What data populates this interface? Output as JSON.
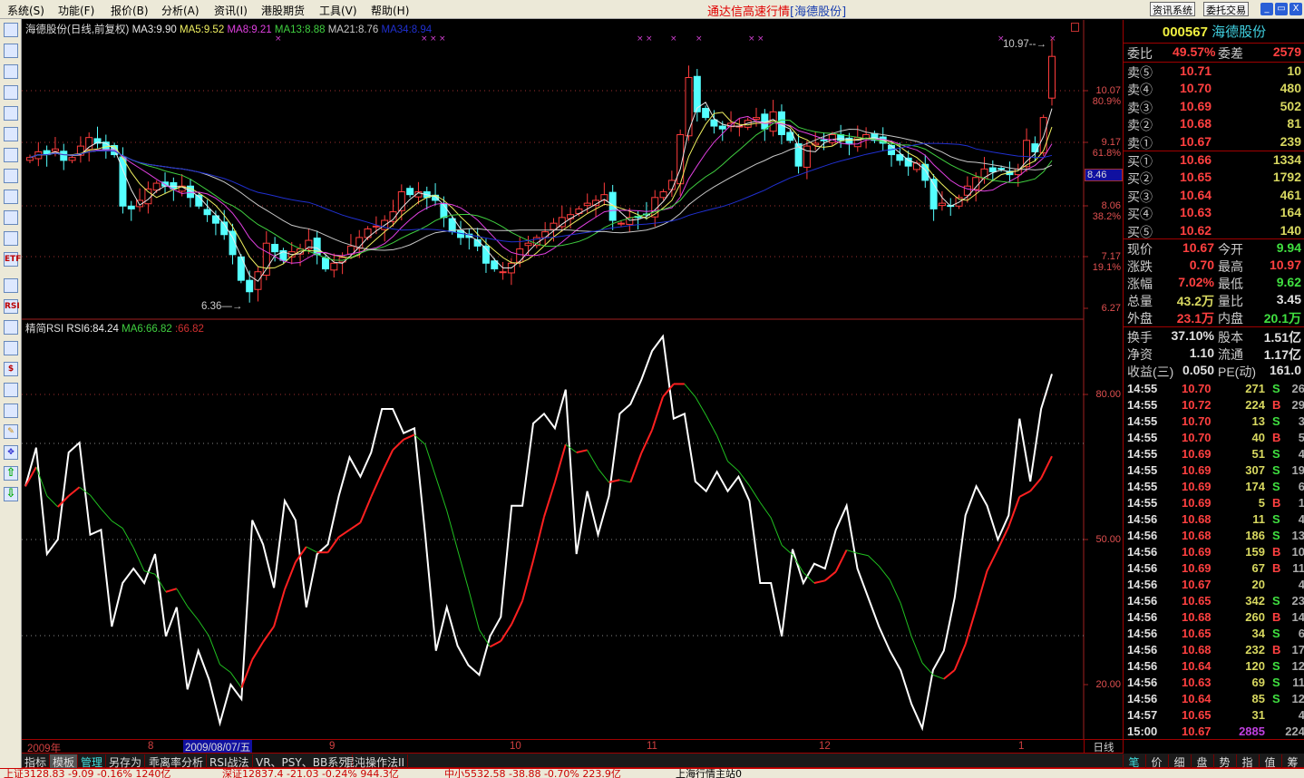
{
  "menu": [
    "系统(S)",
    "功能(F)",
    "报价(B)",
    "分析(A)",
    "资讯(I)",
    "港股期货",
    "工具(V)",
    "帮助(H)"
  ],
  "app_title": "通达信高速行情",
  "app_title_stock": "[海德股份]",
  "top_buttons": {
    "news": "资讯系统",
    "trade": "委托交易"
  },
  "window_buttons": {
    "min": "_",
    "restore": "▭",
    "close": "X"
  },
  "left_toolbar_icons": [
    "quote-icon",
    "grid-icon",
    "line-chart-icon",
    "kline-icon",
    "windows-icon",
    "list-icon",
    "tree-icon",
    "mail-icon",
    "users-icon",
    "formula-icon",
    "search-icon",
    "etf-icon",
    "wave-icon",
    "rsi-icon",
    "refresh-icon",
    "layout-icon",
    "dollar-icon",
    "tools-icon",
    "import-icon",
    "pencil-icon",
    "move-icon",
    "up-arrow-icon",
    "down-arrow-icon"
  ],
  "left_toolbar_text": {
    "etf": "ETF",
    "rsi": "RSI"
  },
  "main_chart": {
    "title": "海德股份(日线,前复权)",
    "ma": [
      {
        "label": "MA3:9.90",
        "color": "#e8e8e8",
        "period": 3
      },
      {
        "label": "MA5:9.52",
        "color": "#f0f060",
        "period": 5
      },
      {
        "label": "MA8:9.21",
        "color": "#e040e0",
        "period": 8
      },
      {
        "label": "MA13:8.88",
        "color": "#40d040",
        "period": 13
      },
      {
        "label": "MA21:8.76",
        "color": "#c8c8c8",
        "period": 21
      },
      {
        "label": "MA34:8.94",
        "color": "#2030d0",
        "period": 34
      }
    ],
    "price_axis": [
      {
        "price": "10.07",
        "pct": "80.9%"
      },
      {
        "price": "9.17",
        "pct": "61.8%"
      },
      {
        "price": "8.06",
        "pct": "38.2%"
      },
      {
        "price": "7.17",
        "pct": "19.1%"
      },
      {
        "price": "6.27",
        "pct": ""
      }
    ],
    "cursor_price": "8.46",
    "high_label": "10.97",
    "low_label": "6.36",
    "last_open": 9.94,
    "high_value": 10.97,
    "low_value": 6.36,
    "low_index": 26,
    "closes": [
      8.9,
      9.0,
      8.95,
      9.05,
      8.85,
      8.9,
      9.1,
      9.25,
      9.15,
      9.05,
      8.95,
      8.05,
      8.0,
      8.15,
      8.35,
      8.45,
      8.4,
      8.35,
      8.4,
      8.2,
      8.05,
      7.9,
      7.75,
      7.55,
      7.2,
      6.75,
      6.55,
      6.9,
      7.4,
      7.25,
      7.1,
      7.25,
      7.3,
      7.45,
      7.2,
      6.95,
      7.05,
      7.15,
      7.35,
      7.5,
      7.65,
      7.7,
      7.8,
      7.95,
      8.3,
      8.25,
      8.3,
      8.2,
      8.15,
      7.85,
      7.6,
      7.5,
      7.5,
      7.35,
      7.05,
      6.95,
      6.9,
      7.05,
      7.3,
      7.4,
      7.5,
      7.6,
      7.75,
      7.85,
      7.9,
      8.0,
      8.1,
      8.15,
      8.25,
      7.8,
      7.75,
      7.85,
      7.85,
      7.9,
      8.2,
      8.3,
      8.5,
      9.3,
      10.3,
      9.7,
      9.6,
      9.45,
      9.4,
      9.5,
      9.45,
      9.55,
      9.6,
      9.4,
      9.7,
      9.3,
      9.2,
      8.75,
      9.1,
      9.15,
      9.2,
      9.3,
      9.2,
      9.15,
      9.25,
      9.3,
      9.2,
      9.15,
      8.95,
      8.85,
      8.75,
      8.8,
      8.5,
      8.0,
      8.1,
      8.05,
      8.2,
      8.4,
      8.55,
      8.7,
      8.65,
      8.7,
      8.6,
      8.7,
      9.2,
      9.0,
      9.6,
      10.67
    ]
  },
  "rsi_chart": {
    "title": "精简RSI",
    "rsi_label": "RSI6:84.24",
    "ma_label": "MA6:66.82",
    "extra_label": ":66.82",
    "axis": [
      "80.00",
      "50.00",
      "20.00"
    ],
    "rsi6": [
      61,
      69,
      47,
      50,
      68,
      70,
      51,
      52,
      32,
      41,
      44,
      41,
      47,
      30,
      36,
      19,
      27,
      21,
      12,
      20,
      17,
      54,
      49,
      40,
      58,
      54,
      36,
      47,
      49,
      59,
      67,
      63,
      68,
      77,
      77,
      72,
      73,
      51,
      27,
      36,
      28,
      24,
      22,
      30,
      34,
      57,
      57,
      74,
      76,
      73,
      81,
      47,
      60,
      51,
      59,
      76,
      78,
      83,
      89,
      92,
      75,
      76,
      62,
      60,
      64,
      60,
      63,
      58,
      41,
      41,
      30,
      48,
      41,
      45,
      44,
      52,
      57,
      44,
      38,
      32,
      27,
      23,
      16,
      11,
      23,
      27,
      38,
      55,
      61,
      57,
      50,
      55,
      75,
      62,
      77,
      84.24
    ]
  },
  "date_axis": {
    "year": "2009年",
    "m8": "8",
    "cursor_date": "2009/08/07/五",
    "m9": "9",
    "m10": "10",
    "m11": "11",
    "m12": "12",
    "m1": "1",
    "period": "日线"
  },
  "bottom_tabs": [
    "指标",
    "模板",
    "管理",
    "另存为",
    "乖离率分析",
    "RSI战法",
    "VR、PSY、BB系列",
    "混沌操作法II"
  ],
  "right_tabs": [
    "笔",
    "价",
    "细",
    "盘",
    "势",
    "指",
    "值",
    "筹"
  ],
  "quote": {
    "code": "000567",
    "name": "海德股份",
    "weibi_label": "委比",
    "weibi": "49.57%",
    "weicha_label": "委差",
    "weicha": "2579",
    "sell": [
      {
        "label": "卖⑤",
        "price": "10.71",
        "vol": "10"
      },
      {
        "label": "卖④",
        "price": "10.70",
        "vol": "480"
      },
      {
        "label": "卖③",
        "price": "10.69",
        "vol": "502"
      },
      {
        "label": "卖②",
        "price": "10.68",
        "vol": "81"
      },
      {
        "label": "卖①",
        "price": "10.67",
        "vol": "239"
      }
    ],
    "buy": [
      {
        "label": "买①",
        "price": "10.66",
        "vol": "1334"
      },
      {
        "label": "买②",
        "price": "10.65",
        "vol": "1792"
      },
      {
        "label": "买③",
        "price": "10.64",
        "vol": "461"
      },
      {
        "label": "买④",
        "price": "10.63",
        "vol": "164"
      },
      {
        "label": "买⑤",
        "price": "10.62",
        "vol": "140"
      }
    ],
    "stats": [
      {
        "l1": "现价",
        "v1": "10.67",
        "c1": "red",
        "l2": "今开",
        "v2": "9.94",
        "c2": "grn"
      },
      {
        "l1": "涨跌",
        "v1": "0.70",
        "c1": "red",
        "l2": "最高",
        "v2": "10.97",
        "c2": "red"
      },
      {
        "l1": "涨幅",
        "v1": "7.02%",
        "c1": "red",
        "l2": "最低",
        "v2": "9.62",
        "c2": "grn"
      },
      {
        "l1": "总量",
        "v1": "43.2万",
        "c1": "yel",
        "l2": "量比",
        "v2": "3.45",
        "c2": "wht"
      },
      {
        "l1": "外盘",
        "v1": "23.1万",
        "c1": "red",
        "l2": "内盘",
        "v2": "20.1万",
        "c2": "grn"
      }
    ],
    "fundamentals": [
      {
        "l1": "换手",
        "v1": "37.10%",
        "l2": "股本",
        "v2": "1.51亿"
      },
      {
        "l1": "净资",
        "v1": "1.10",
        "l2": "流通",
        "v2": "1.17亿"
      },
      {
        "l1": "收益(三)",
        "v1": "0.050",
        "l2": "PE(动)",
        "v2": "161.0"
      }
    ]
  },
  "trades": [
    {
      "t": "14:55",
      "p": "10.70",
      "v": "271",
      "s": "S",
      "n": "26"
    },
    {
      "t": "14:55",
      "p": "10.72",
      "v": "224",
      "s": "B",
      "n": "29"
    },
    {
      "t": "14:55",
      "p": "10.70",
      "v": "13",
      "s": "S",
      "n": "3"
    },
    {
      "t": "14:55",
      "p": "10.70",
      "v": "40",
      "s": "B",
      "n": "5"
    },
    {
      "t": "14:55",
      "p": "10.69",
      "v": "51",
      "s": "S",
      "n": "4"
    },
    {
      "t": "14:55",
      "p": "10.69",
      "v": "307",
      "s": "S",
      "n": "19"
    },
    {
      "t": "14:55",
      "p": "10.69",
      "v": "174",
      "s": "S",
      "n": "6"
    },
    {
      "t": "14:55",
      "p": "10.69",
      "v": "5",
      "s": "B",
      "n": "1"
    },
    {
      "t": "14:56",
      "p": "10.68",
      "v": "11",
      "s": "S",
      "n": "4"
    },
    {
      "t": "14:56",
      "p": "10.68",
      "v": "186",
      "s": "S",
      "n": "13"
    },
    {
      "t": "14:56",
      "p": "10.69",
      "v": "159",
      "s": "B",
      "n": "10"
    },
    {
      "t": "14:56",
      "p": "10.69",
      "v": "67",
      "s": "B",
      "n": "11"
    },
    {
      "t": "14:56",
      "p": "10.67",
      "v": "20",
      "s": "",
      "n": "4"
    },
    {
      "t": "14:56",
      "p": "10.65",
      "v": "342",
      "s": "S",
      "n": "23"
    },
    {
      "t": "14:56",
      "p": "10.68",
      "v": "260",
      "s": "B",
      "n": "14"
    },
    {
      "t": "14:56",
      "p": "10.65",
      "v": "34",
      "s": "S",
      "n": "6"
    },
    {
      "t": "14:56",
      "p": "10.68",
      "v": "232",
      "s": "B",
      "n": "17"
    },
    {
      "t": "14:56",
      "p": "10.64",
      "v": "120",
      "s": "S",
      "n": "12"
    },
    {
      "t": "14:56",
      "p": "10.63",
      "v": "69",
      "s": "S",
      "n": "11"
    },
    {
      "t": "14:56",
      "p": "10.64",
      "v": "85",
      "s": "S",
      "n": "12"
    },
    {
      "t": "14:57",
      "p": "10.65",
      "v": "31",
      "s": "",
      "n": "4"
    },
    {
      "t": "15:00",
      "p": "10.67",
      "v": "2885",
      "s": "",
      "n": "224"
    }
  ],
  "status_bar": {
    "sh": "上证3128.83 -9.09 -0.16% 1240亿",
    "sz": "深证12837.4 -21.03 -0.24% 944.3亿",
    "zx": "中小5532.58 -38.88 -0.70% 223.9亿",
    "server": "上海行情主站0"
  },
  "colors": {
    "up": "#ff3c3c",
    "down": "#54ffff",
    "grid": "#a02020",
    "rsi": "#ffffff",
    "rsi_ma_up": "#ff2020",
    "rsi_ma_down": "#20c020",
    "marker": "#d040d0"
  }
}
